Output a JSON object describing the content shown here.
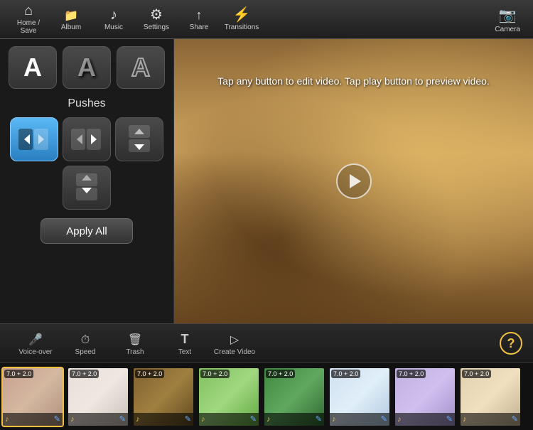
{
  "toolbar": {
    "items": [
      {
        "id": "home-save",
        "label": "Home / Save",
        "icon": "home"
      },
      {
        "id": "album",
        "label": "Album",
        "icon": "album"
      },
      {
        "id": "music",
        "label": "Music",
        "icon": "music"
      },
      {
        "id": "settings",
        "label": "Settings",
        "icon": "settings"
      },
      {
        "id": "share",
        "label": "Share",
        "icon": "share"
      },
      {
        "id": "transitions",
        "label": "Transitions",
        "icon": "transitions"
      }
    ],
    "camera_label": "Camera"
  },
  "left_panel": {
    "section_label": "Pushes",
    "apply_all_label": "Apply All"
  },
  "video": {
    "hint": "Tap any button to edit video. Tap play button\nto preview video."
  },
  "bottom_toolbar": {
    "items": [
      {
        "id": "voice-over",
        "label": "Voice-over",
        "icon": "mic"
      },
      {
        "id": "speed",
        "label": "Speed",
        "icon": "speed"
      },
      {
        "id": "trash",
        "label": "Trash",
        "icon": "trash"
      },
      {
        "id": "text",
        "label": "Text",
        "icon": "text"
      },
      {
        "id": "create-video",
        "label": "Create Video",
        "icon": "play-btn"
      }
    ],
    "help_label": "?"
  },
  "filmstrip": {
    "items": [
      {
        "id": 1,
        "time": "7.0 + 2.0",
        "selected": true
      },
      {
        "id": 2,
        "time": "7.0 + 2.0",
        "selected": false
      },
      {
        "id": 3,
        "time": "7.0 + 2.0",
        "selected": false
      },
      {
        "id": 4,
        "time": "7.0 + 2.0",
        "selected": false
      },
      {
        "id": 5,
        "time": "7.0 + 2.0",
        "selected": false
      },
      {
        "id": 6,
        "time": "7.0 + 2.0",
        "selected": false
      },
      {
        "id": 7,
        "time": "7.0 + 2.0",
        "selected": false
      },
      {
        "id": 8,
        "time": "7.0 + 2.0",
        "selected": false
      }
    ]
  },
  "colors": {
    "accent_yellow": "#f0c040",
    "accent_blue": "#5bb8f5",
    "bg_dark": "#1a1a1a",
    "active_trans": "#2a7fc1"
  }
}
